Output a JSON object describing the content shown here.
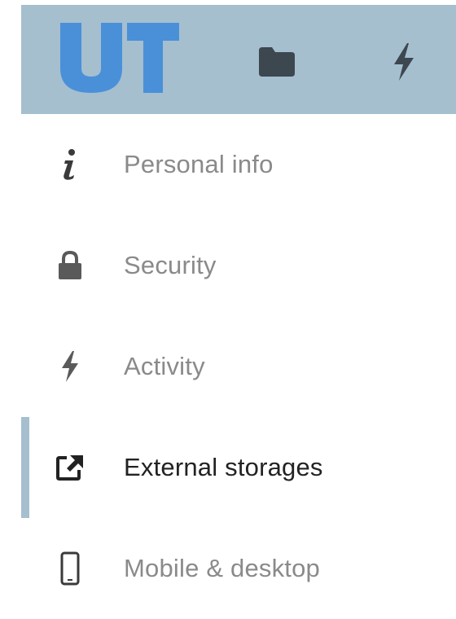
{
  "header": {
    "logo_text": "UT",
    "apps": [
      {
        "name": "Files",
        "icon": "folder-icon"
      },
      {
        "name": "Activity",
        "icon": "lightning-icon"
      }
    ],
    "background": "#a5bfcf",
    "logo_color": "#4a90d9"
  },
  "sidebar": {
    "items": [
      {
        "label": "Personal info",
        "icon": "info-icon",
        "active": false
      },
      {
        "label": "Security",
        "icon": "lock-icon",
        "active": false
      },
      {
        "label": "Activity",
        "icon": "lightning-icon",
        "active": false
      },
      {
        "label": "External storages",
        "icon": "external-link-icon",
        "active": true
      },
      {
        "label": "Mobile & desktop",
        "icon": "phone-icon",
        "active": false
      }
    ],
    "active_indicator_color": "#a5bfcf"
  }
}
